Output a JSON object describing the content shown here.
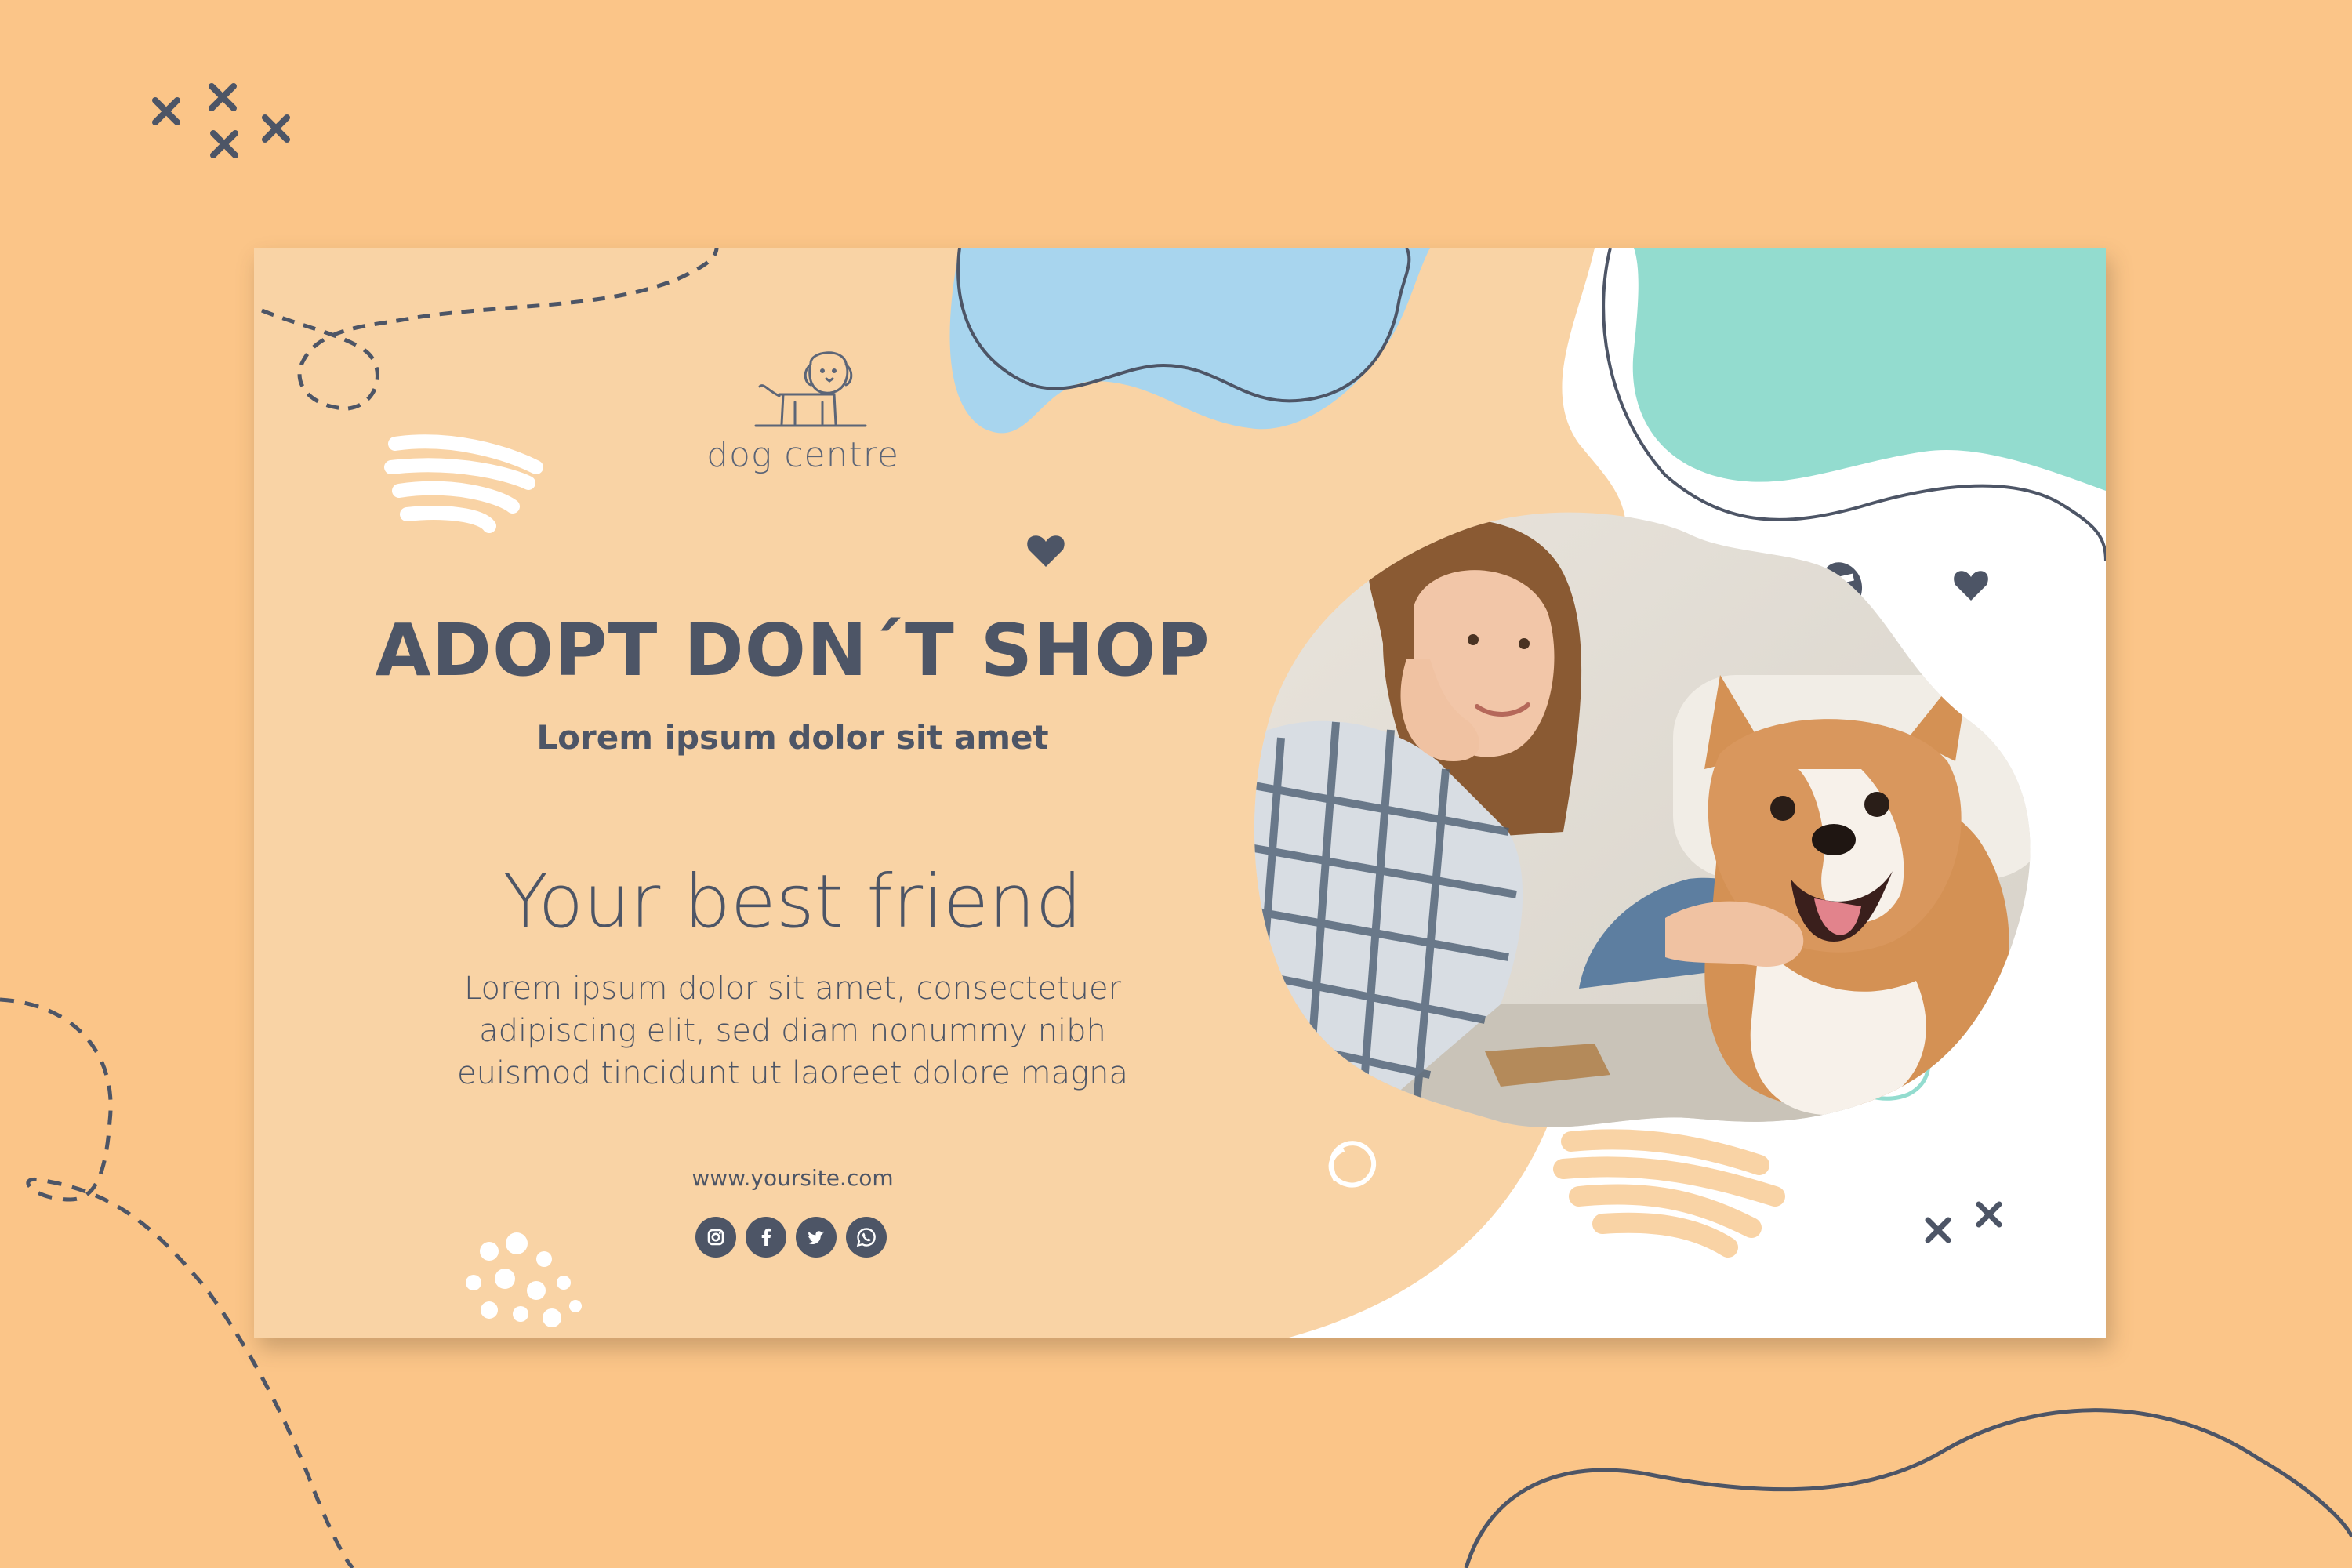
{
  "brand": {
    "logo_text": "dog centre"
  },
  "hero": {
    "headline": "ADOPT DON´T SHOP",
    "subheadline": "Lorem ipsum dolor sit amet",
    "tagline": "Your best friend",
    "body_lines": [
      "Lorem ipsum dolor sit amet, consectetuer",
      "adipiscing elit, sed diam nonummy nibh",
      "euismod tincidunt ut laoreet dolore magna"
    ]
  },
  "footer": {
    "website": "www.yoursite.com",
    "social_icons": [
      "instagram-icon",
      "facebook-icon",
      "twitter-icon",
      "whatsapp-icon"
    ]
  },
  "colors": {
    "page_background": "#fbc588",
    "banner_background": "#f9d3a5",
    "text_dark": "#4d5566",
    "blob_blue": "#a8d5ee",
    "blob_mint": "#93dccf",
    "white": "#ffffff"
  }
}
